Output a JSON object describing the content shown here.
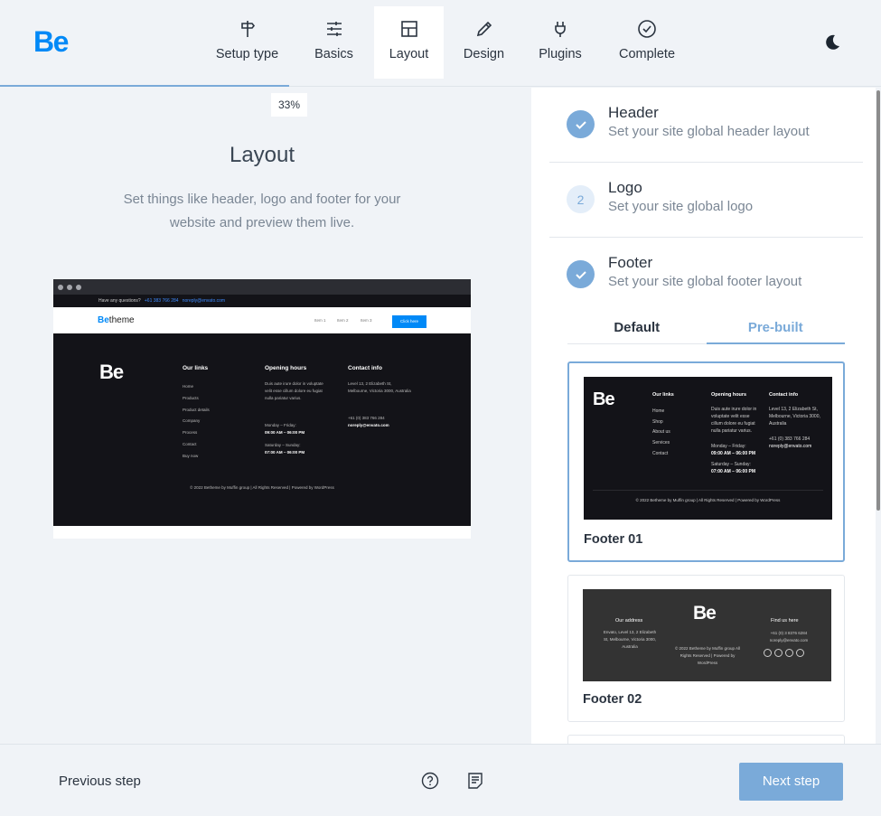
{
  "brand": {
    "logo": "Be"
  },
  "steps": [
    {
      "label": "Setup type",
      "state": "done",
      "icon": "signpost-icon"
    },
    {
      "label": "Basics",
      "state": "done",
      "icon": "sliders-icon"
    },
    {
      "label": "Layout",
      "state": "active",
      "icon": "layout-icon"
    },
    {
      "label": "Design",
      "state": "todo",
      "icon": "pencil-icon"
    },
    {
      "label": "Plugins",
      "state": "todo",
      "icon": "plug-icon"
    },
    {
      "label": "Complete",
      "state": "todo",
      "icon": "check-circle-icon"
    }
  ],
  "progress": {
    "value": 33,
    "label": "33%"
  },
  "left": {
    "title": "Layout",
    "description": "Set things like header, logo and footer for your website and preview them live."
  },
  "preview": {
    "topline": {
      "question": "Have any questions?",
      "phone": "+61 383 766 284",
      "email": "noreply@envato.com"
    },
    "nav": {
      "brand_a": "Be",
      "brand_b": "theme",
      "items": [
        "Item 1",
        "Item 2",
        "Item 3"
      ],
      "button": "Click here"
    },
    "footer": {
      "logo": "Be",
      "links_title": "Our links",
      "links": [
        "Home",
        "Products",
        "Product details",
        "Company",
        "Process",
        "Contact",
        "Buy now"
      ],
      "hours_title": "Opening hours",
      "hours_text": "Duis aute irure dolor in voluptate velit esse cillum dolore eu fugiat nulla pariatur varius.",
      "weekdays": "Monday – Friday:",
      "weekdays_time": "09:00 AM – 06:00 PM",
      "weekend": "Saturday – Sunday:",
      "weekend_time": "07:00 AM – 06:00 PM",
      "contact_title": "Contact info",
      "address": "Level 13, 2 Elizabeth St, Melbourne, Victoria 3000, Australia",
      "phone": "+61 (0) 383 766 284",
      "email": "noreply@envato.com",
      "copyright": "© 2022 Betheme by Muffin group | All Rights Reserved | Powered by WordPress"
    }
  },
  "sections": [
    {
      "title": "Header",
      "subtitle": "Set your site global header layout",
      "status": "done"
    },
    {
      "title": "Logo",
      "subtitle": "Set your site global logo",
      "status": "number",
      "number": "2"
    },
    {
      "title": "Footer",
      "subtitle": "Set your site global footer layout",
      "status": "done"
    }
  ],
  "tabs": {
    "default": "Default",
    "prebuilt": "Pre-built",
    "selected": "prebuilt"
  },
  "cards": [
    {
      "label": "Footer 01",
      "selected": true,
      "logo": "Be",
      "links_title": "Our links",
      "links": [
        "Home",
        "Shop",
        "About us",
        "Services",
        "Contact"
      ],
      "hours_title": "Opening hours",
      "hours_text": "Duis aute irure dolor in voluptate velit esse cillum dolore eu fugiat nulla pariatur varius.",
      "weekdays": "Monday – Friday:",
      "weekdays_time": "09:00 AM – 06:00 PM",
      "weekend": "Saturday – Sunday:",
      "weekend_time": "07:00 AM – 06:00 PM",
      "contact_title": "Contact info",
      "address": "Level 13, 2 Elizabeth St, Melbourne, Victoria 3000, Australia",
      "phone": "+61 (0) 383 766 284",
      "email": "noreply@envato.com",
      "copyright": "© 2022 Betheme by Muffin group | All Rights Reserved | Powered by WordPress"
    },
    {
      "label": "Footer 02",
      "selected": false,
      "logo": "Be",
      "address_title": "Our address",
      "address": "Envato, Level 13, 2 Elizabeth St, Melbourne, Victoria 3000, Australia",
      "copyright": "© 2022 Betheme by Muffin group All Rights Reserved | Powered by WordPress",
      "find_title": "Find us here",
      "phone": "+61 (0) 3 8376 6284",
      "email": "noreply@envato.com"
    }
  ],
  "bottom": {
    "previous": "Previous step",
    "next": "Next step"
  },
  "colors": {
    "accent": "#7aaad9",
    "brand": "#0089f7",
    "dark_footer": "#131318",
    "footer2": "#333333"
  }
}
